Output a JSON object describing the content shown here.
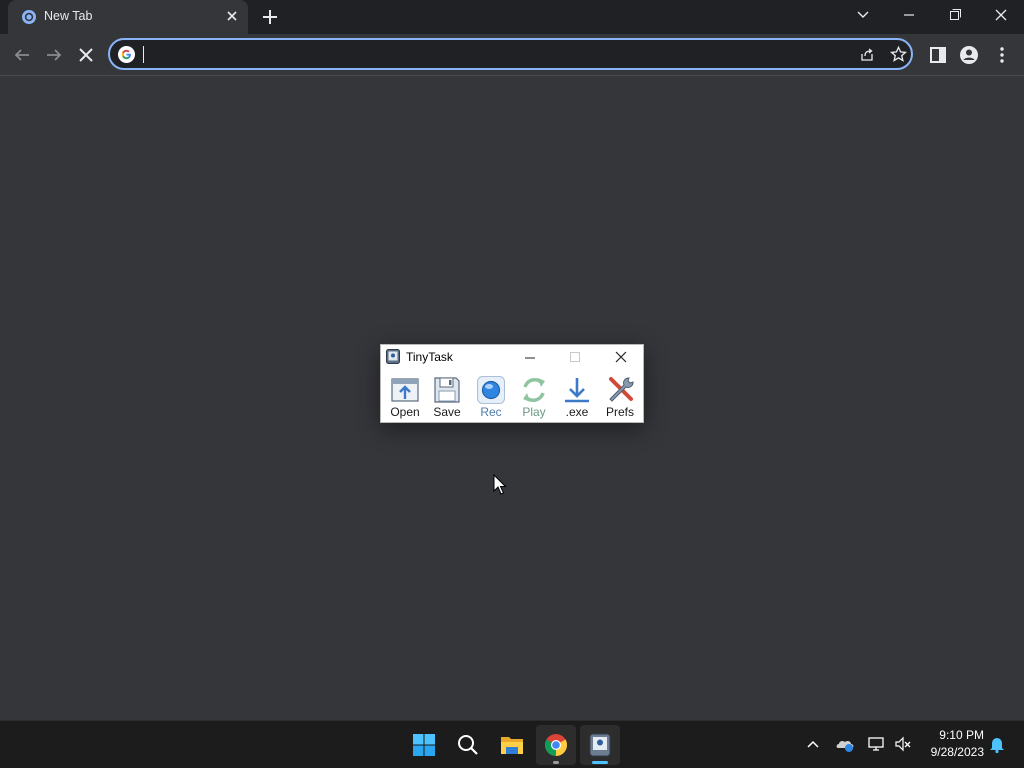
{
  "browser": {
    "tab": {
      "title": "New Tab",
      "close_icon": "close-icon"
    },
    "new_tab_icon": "plus-icon",
    "window_controls": [
      "chevron-down-icon",
      "minimize-icon",
      "restore-icon",
      "close-icon"
    ],
    "toolbar": {
      "back_icon": "arrow-back-icon",
      "forward_icon": "arrow-forward-icon",
      "stop_icon": "stop-loading-icon",
      "omnibox_value": "",
      "omnibox_icon": "google-g-icon",
      "share_icon": "share-icon",
      "bookmark_icon": "star-icon",
      "side_panel_icon": "side-panel-icon",
      "profile_icon": "profile-icon",
      "menu_icon": "kebab-menu-icon"
    },
    "colors": {
      "accent": "#8ab4f8",
      "background": "#35363a",
      "tabstrip": "#202124"
    }
  },
  "tinytask": {
    "title": "TinyTask",
    "tools": [
      {
        "label": "Open",
        "icon": "open-folder-icon"
      },
      {
        "label": "Save",
        "icon": "save-disk-icon"
      },
      {
        "label": "Rec",
        "icon": "record-icon"
      },
      {
        "label": "Play",
        "icon": "play-cycle-icon"
      },
      {
        "label": ".exe",
        "icon": "download-arrow-icon"
      },
      {
        "label": "Prefs",
        "icon": "wrench-tools-icon"
      }
    ]
  },
  "taskbar": {
    "apps": [
      {
        "name": "Start",
        "icon": "windows-start-icon"
      },
      {
        "name": "Search",
        "icon": "search-icon"
      },
      {
        "name": "File Explorer",
        "icon": "folder-icon"
      },
      {
        "name": "Google Chrome",
        "icon": "chrome-icon"
      },
      {
        "name": "TinyTask",
        "icon": "tinytask-icon"
      }
    ],
    "tray_icons": [
      "chevron-up-icon",
      "onedrive-icon",
      "network-icon",
      "volume-muted-icon",
      "notification-bell-icon"
    ],
    "clock": {
      "time": "9:10 PM",
      "date": "9/28/2023"
    }
  }
}
